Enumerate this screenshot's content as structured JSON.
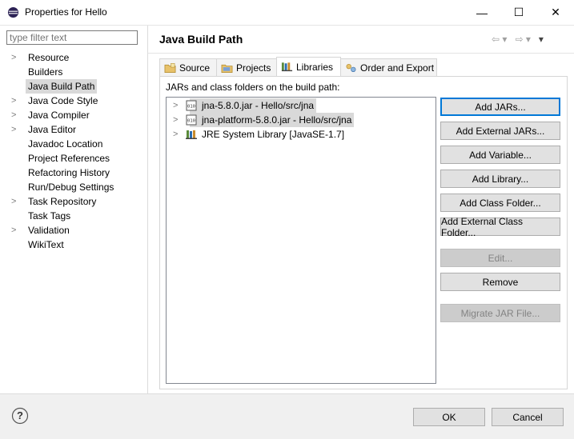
{
  "window": {
    "title": "Properties for Hello",
    "controls": {
      "minimize": "—",
      "maximize": "☐",
      "close": "✕"
    }
  },
  "sidebar": {
    "filter_placeholder": "type filter text",
    "items": [
      {
        "label": "Resource",
        "expandable": true
      },
      {
        "label": "Builders",
        "expandable": false
      },
      {
        "label": "Java Build Path",
        "expandable": false,
        "selected": true
      },
      {
        "label": "Java Code Style",
        "expandable": true
      },
      {
        "label": "Java Compiler",
        "expandable": true
      },
      {
        "label": "Java Editor",
        "expandable": true
      },
      {
        "label": "Javadoc Location",
        "expandable": false
      },
      {
        "label": "Project References",
        "expandable": false
      },
      {
        "label": "Refactoring History",
        "expandable": false
      },
      {
        "label": "Run/Debug Settings",
        "expandable": false
      },
      {
        "label": "Task Repository",
        "expandable": true
      },
      {
        "label": "Task Tags",
        "expandable": false
      },
      {
        "label": "Validation",
        "expandable": true
      },
      {
        "label": "WikiText",
        "expandable": false
      }
    ]
  },
  "main": {
    "title": "Java Build Path",
    "nav": {
      "back": "⇦ ▾",
      "forward": "⇨ ▾",
      "menu": "▾"
    },
    "tabs": [
      {
        "label": "Source",
        "icon": "source-folder-icon"
      },
      {
        "label": "Projects",
        "icon": "projects-folder-icon"
      },
      {
        "label": "Libraries",
        "icon": "libraries-icon",
        "active": true
      },
      {
        "label": "Order and Export",
        "icon": "order-export-icon"
      }
    ],
    "section_label": "JARs and class folders on the build path:",
    "entries": [
      {
        "label": "jna-5.8.0.jar - Hello/src/jna",
        "icon": "jar-icon"
      },
      {
        "label": "jna-platform-5.8.0.jar - Hello/src/jna",
        "icon": "jar-icon"
      },
      {
        "label": "JRE System Library [JavaSE-1.7]",
        "icon": "library-icon"
      }
    ],
    "buttons": {
      "add_jars": "Add JARs...",
      "add_external_jars": "Add External JARs...",
      "add_variable": "Add Variable...",
      "add_library": "Add Library...",
      "add_class_folder": "Add Class Folder...",
      "add_external_class_folder": "Add External Class Folder...",
      "edit": "Edit...",
      "remove": "Remove",
      "migrate_jar": "Migrate JAR File..."
    }
  },
  "footer": {
    "help": "?",
    "ok": "OK",
    "cancel": "Cancel"
  },
  "colors": {
    "selection": "#d9d9d9",
    "accent": "#0078d7",
    "eclipse_purple": "#2c2255"
  }
}
